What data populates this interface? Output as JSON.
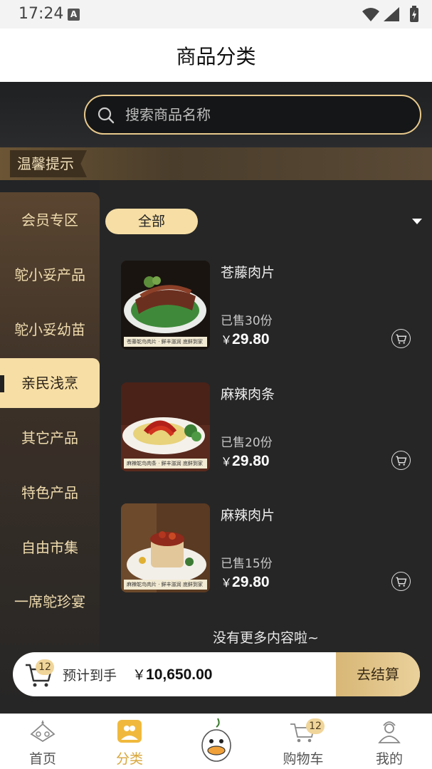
{
  "status_bar": {
    "time": "17:24"
  },
  "header": {
    "title": "商品分类"
  },
  "search": {
    "placeholder": "搜索商品名称"
  },
  "notice": {
    "label": "温馨提示"
  },
  "sidebar": {
    "items": [
      {
        "label": "会员专区",
        "active": false
      },
      {
        "label": "鸵小妥产品",
        "active": false
      },
      {
        "label": "鸵小妥幼苗",
        "active": false
      },
      {
        "label": "亲民浅烹",
        "active": true
      },
      {
        "label": "其它产品",
        "active": false
      },
      {
        "label": "特色产品",
        "active": false
      },
      {
        "label": "自由市集",
        "active": false
      },
      {
        "label": "一席鸵珍宴",
        "active": false
      }
    ]
  },
  "filter": {
    "selected": "全部"
  },
  "products": [
    {
      "name": "苍藤肉片",
      "sold": "已售30份",
      "currency": "￥",
      "price": "29.80",
      "image_caption": "苍藤鸵鸟肉片 · 鲜丰滋润 底鲜到家"
    },
    {
      "name": "麻辣肉条",
      "sold": "已售20份",
      "currency": "￥",
      "price": "29.80",
      "image_caption": "麻辣鸵鸟肉条 · 鲜丰滋润 底鲜到家"
    },
    {
      "name": "麻辣肉片",
      "sold": "已售15份",
      "currency": "￥",
      "price": "29.80",
      "image_caption": "麻辣鸵鸟肉片 · 鲜丰滋润 底鲜到家"
    }
  ],
  "list_end_text": "没有更多内容啦~",
  "checkout_bar": {
    "cart_count": "12",
    "label": "预计到手",
    "currency": "￥",
    "amount": "10,650.00",
    "button": "去结算"
  },
  "tab_bar": {
    "items": [
      {
        "label": "首页",
        "icon": "home-icon",
        "active": false
      },
      {
        "label": "分类",
        "icon": "category-icon",
        "active": true
      },
      {
        "label": "",
        "icon": "mascot-icon",
        "active": false
      },
      {
        "label": "购物车",
        "icon": "cart-icon",
        "active": false,
        "badge": "12"
      },
      {
        "label": "我的",
        "icon": "profile-icon",
        "active": false
      }
    ]
  },
  "colors": {
    "accent": "#f6dea5",
    "gold": "#d9a73b",
    "dark_bg": "#262626"
  }
}
